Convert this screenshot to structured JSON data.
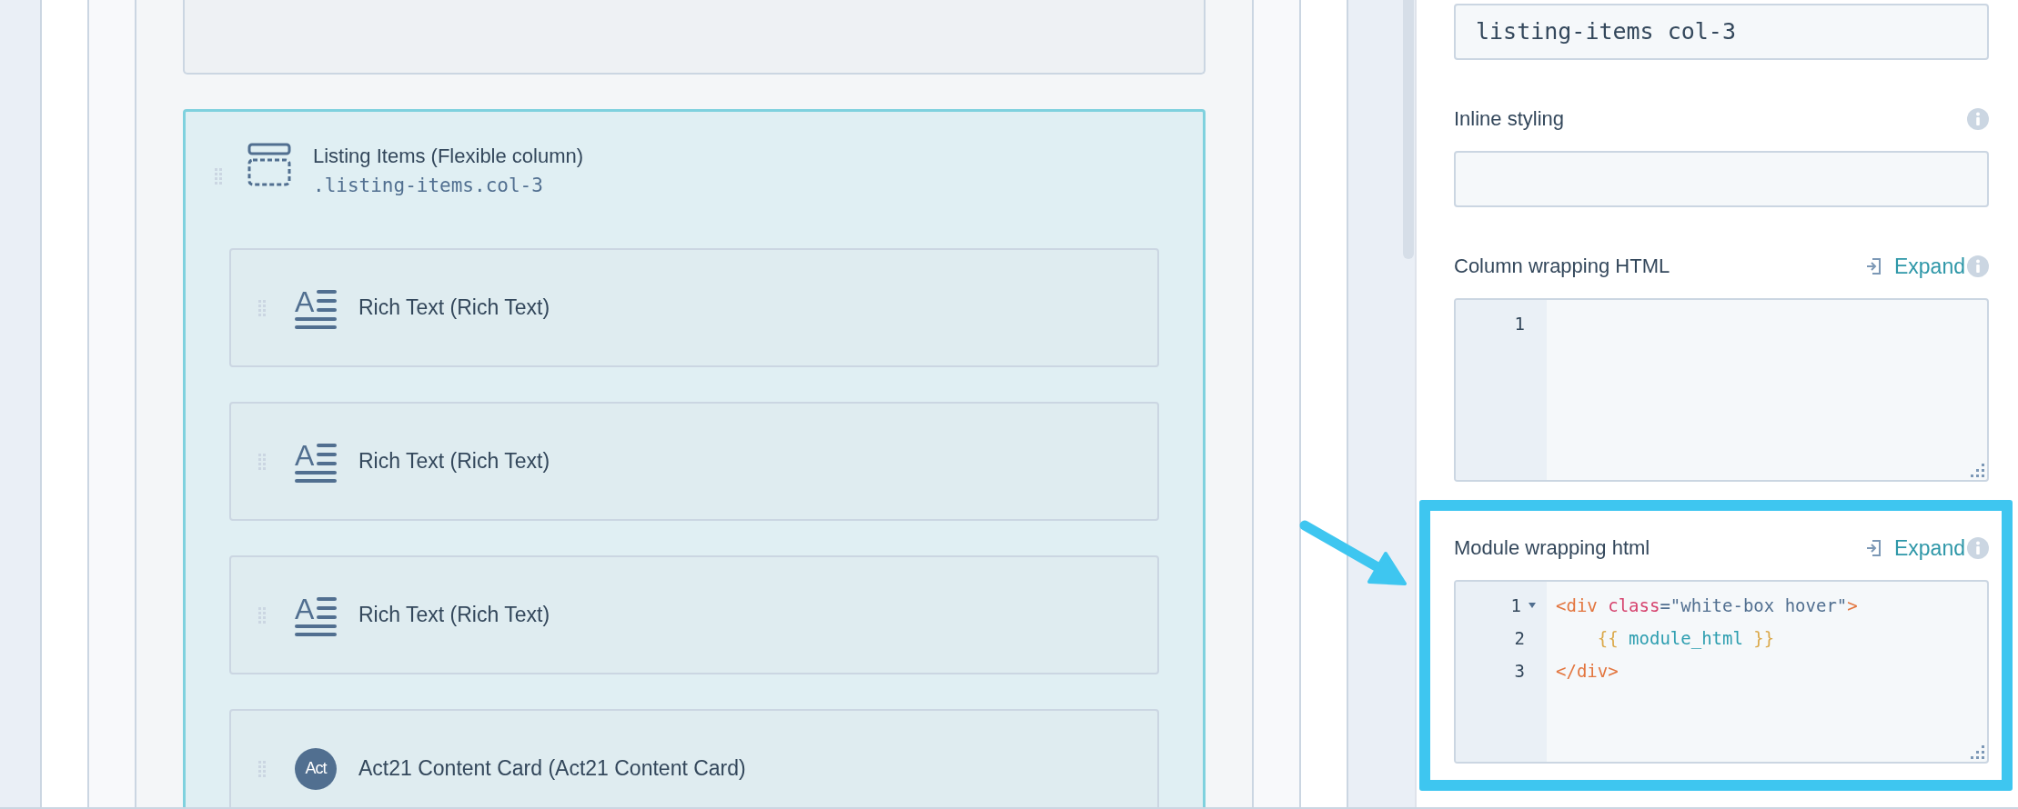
{
  "canvas": {
    "section": {
      "title": "Listing Items (Flexible column)",
      "selector": ".listing-items.col-3",
      "selected": true,
      "modules": [
        {
          "kind": "rich_text",
          "icon_text": "A",
          "label": "Rich Text (Rich Text)"
        },
        {
          "kind": "rich_text",
          "icon_text": "A",
          "label": "Rich Text (Rich Text)"
        },
        {
          "kind": "rich_text",
          "icon_text": "A",
          "label": "Rich Text (Rich Text)"
        },
        {
          "kind": "custom",
          "icon_text": "Act",
          "label": "Act21 Content Card (Act21 Content Card)"
        }
      ]
    }
  },
  "settings": [
    {
      "kind": "input",
      "value": "listing-items col-3"
    },
    {
      "kind": "input",
      "label": "Inline styling",
      "info": true
    },
    {
      "kind": "code",
      "label": "Column wrapping HTML",
      "action": "Expand",
      "info": true,
      "highlighted": false,
      "lines": [
        {
          "number": "1",
          "foldable": false
        }
      ]
    },
    {
      "kind": "code",
      "label": "Module wrapping html",
      "action": "Expand",
      "info": true,
      "highlighted": true,
      "lines": [
        {
          "number": "1",
          "foldable": true,
          "tokens": [
            {
              "color": "#e3763f",
              "text": "<div"
            },
            {
              "color": "#d6436e",
              "text": " class"
            },
            {
              "color": "#516f90",
              "text": "=\"white-box hover\""
            },
            {
              "color": "#e3763f",
              "text": ">"
            }
          ]
        },
        {
          "number": "2",
          "foldable": false,
          "tokens": [
            {
              "color": "#dba94a",
              "text": "    {{"
            },
            {
              "color": "#2d9eb0",
              "text": " module_html "
            },
            {
              "color": "#dba94a",
              "text": "}}"
            }
          ]
        },
        {
          "number": "3",
          "foldable": false,
          "tokens": [
            {
              "color": "#e3763f",
              "text": "</div>"
            }
          ]
        }
      ]
    }
  ]
}
